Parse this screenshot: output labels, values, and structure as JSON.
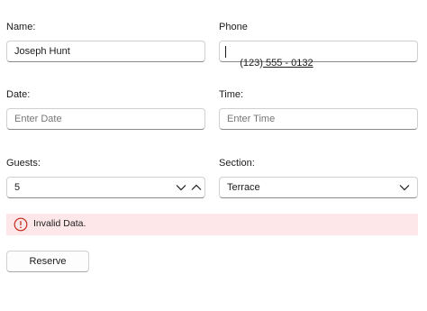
{
  "form": {
    "name": {
      "label": "Name:",
      "value": "Joseph Hunt"
    },
    "phone": {
      "label": "Phone",
      "parts": [
        "(123)",
        " 555 ",
        "- ",
        "0132"
      ]
    },
    "date": {
      "label": "Date:",
      "placeholder": "Enter Date"
    },
    "time": {
      "label": "Time:",
      "placeholder": "Enter Time"
    },
    "guests": {
      "label": "Guests:",
      "value": "5",
      "icons": [
        "chevron-down-icon",
        "chevron-up-icon"
      ]
    },
    "section": {
      "label": "Section:",
      "value": "Terrace",
      "icon": "chevron-down-icon"
    },
    "alert": {
      "text": "Invalid Data.",
      "icon": "error-circle-icon",
      "background": "#fde7e9",
      "icon_color": "#c42b1c"
    },
    "reserve_label": "Reserve"
  }
}
